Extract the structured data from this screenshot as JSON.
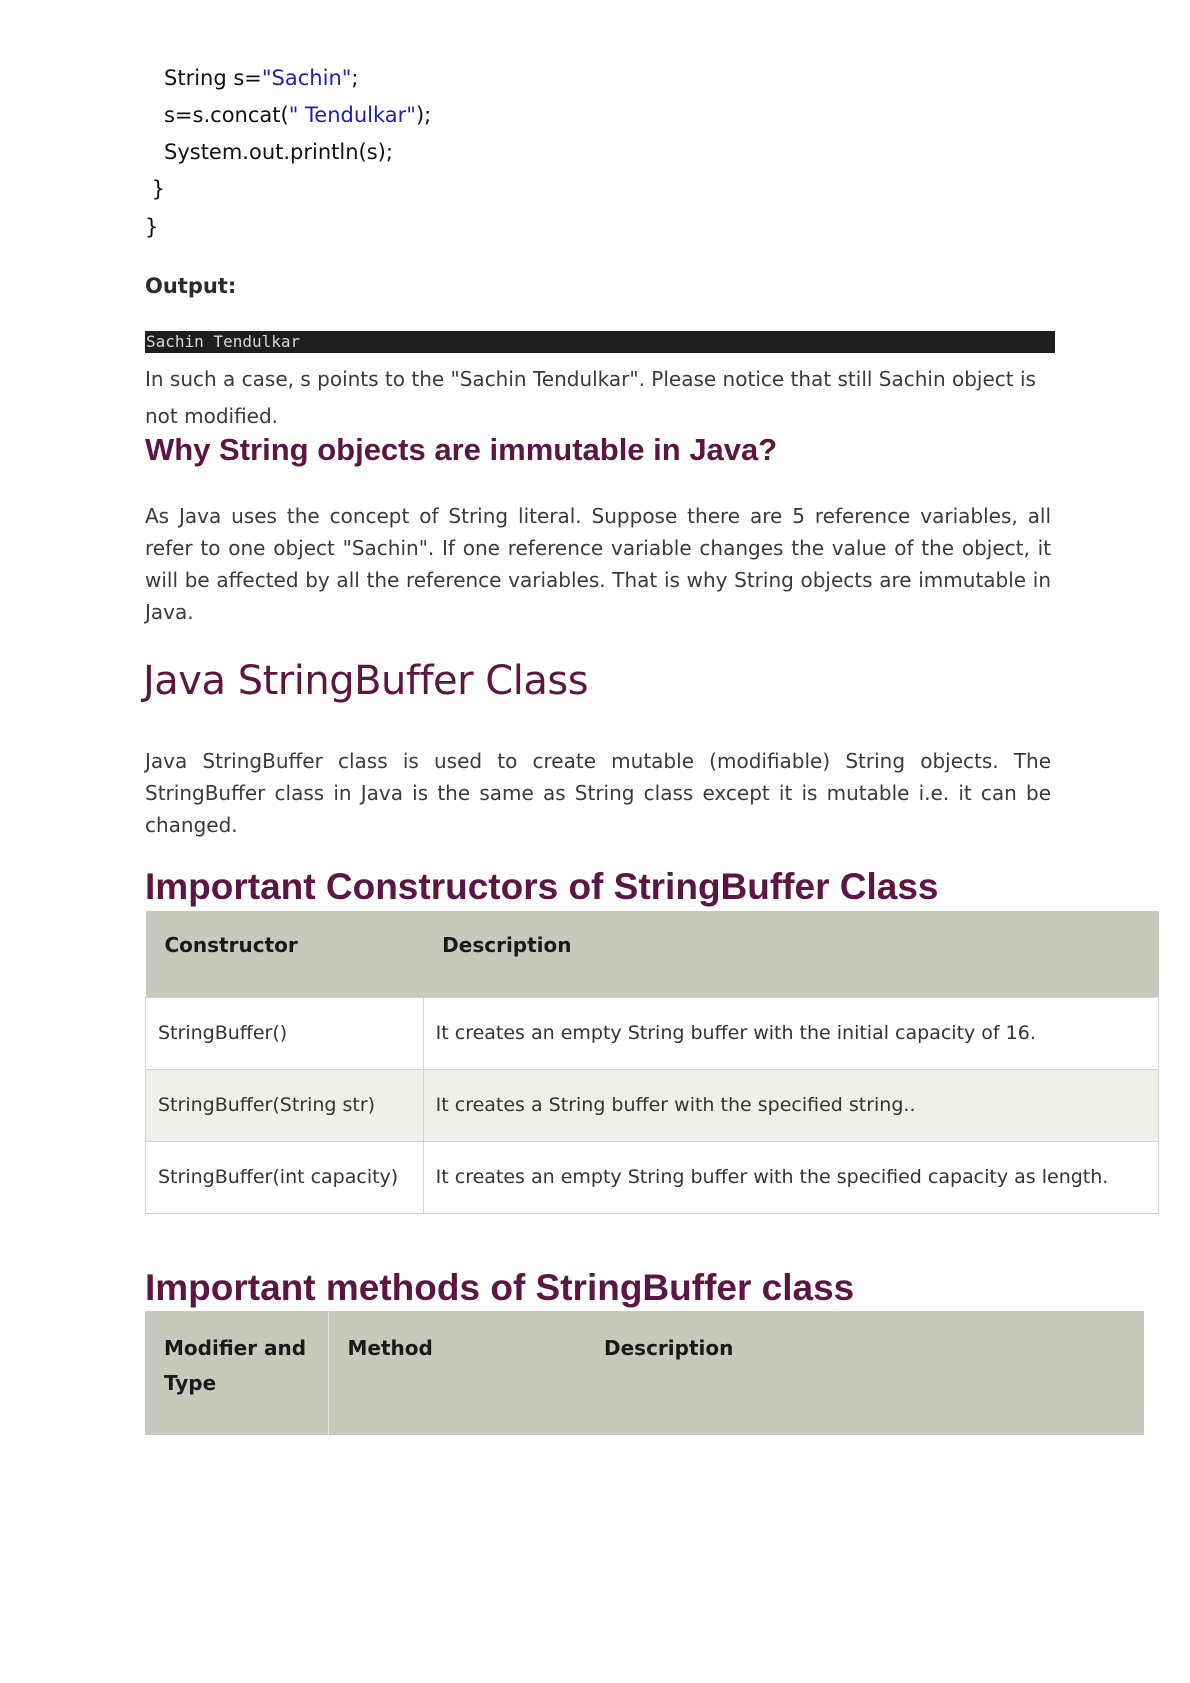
{
  "code": {
    "line1": {
      "prefix": "String s=",
      "string": "\"Sachin\"",
      "suffix": ";"
    },
    "line2": {
      "prefix": "s=s.concat(",
      "string": "\" Tendulkar\"",
      "suffix": ");"
    },
    "line3": "System.out.println(s);",
    "line4": " }",
    "line5": "}"
  },
  "output_label": "Output:",
  "console_output": "Sachin Tendulkar",
  "para_after_output": "In such a case, s points to the \"Sachin Tendulkar\". Please notice that still Sachin object is not modified.",
  "heading_immutable": "Why String objects are immutable in Java?",
  "para_immutable": "As Java uses the concept of String literal. Suppose there are 5 reference variables, all refer to one object \"Sachin\". If one reference variable changes the value of the object, it will be affected by all the reference variables. That is why String objects are immutable in Java.",
  "heading_stringbuffer": "Java StringBuffer Class",
  "para_stringbuffer": "Java StringBuffer class is used to create mutable (modifiable) String objects. The StringBuffer class in Java is the same as String class except it is mutable i.e. it can be changed.",
  "heading_constructors": "Important Constructors of StringBuffer Class",
  "constructors_table": {
    "headers": [
      "Constructor",
      "Description"
    ],
    "rows": [
      {
        "constructor": "StringBuffer()",
        "description": "It creates an empty String buffer with the initial capacity of 16."
      },
      {
        "constructor": "StringBuffer(String str)",
        "description": "It creates a String buffer with the specified string.."
      },
      {
        "constructor": "StringBuffer(int capacity)",
        "description": "It creates an empty String buffer with the specified capacity as length."
      }
    ]
  },
  "heading_methods": "Important methods of StringBuffer class",
  "methods_table": {
    "headers": [
      "Modifier and Type",
      "Method",
      "Description"
    ]
  }
}
